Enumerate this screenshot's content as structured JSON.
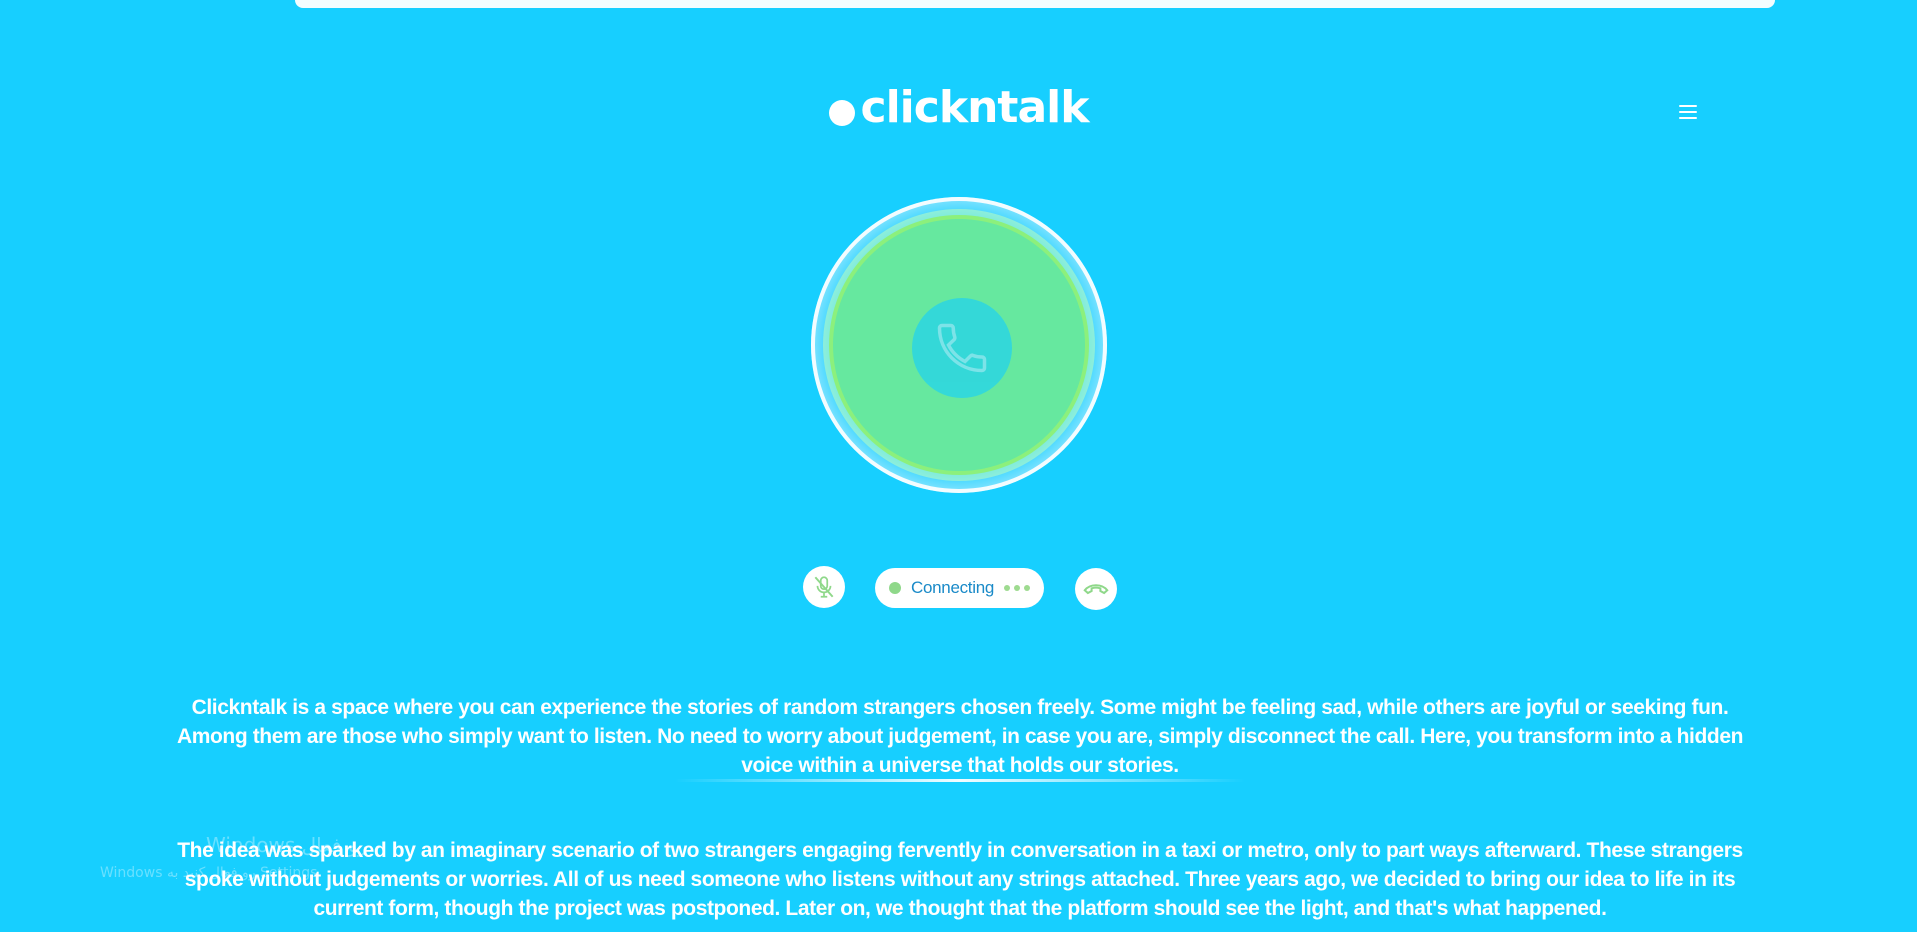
{
  "brand": {
    "logo_text": "clickntalk"
  },
  "menu": {
    "icon": "hamburger-menu-icon"
  },
  "call": {
    "icon": "phone-icon",
    "status_label": "Connecting"
  },
  "controls": {
    "mic_icon": "mic-muted-icon",
    "hangup_icon": "hang-up-icon"
  },
  "about": {
    "paragraph_1": "Clickntalk is a space where you can experience the stories of random strangers chosen freely. Some might be feeling sad, while others are joyful or seeking fun. Among them are those who simply want to listen. No need to worry about judgement, in case you are, simply disconnect the call. Here, you transform into a hidden voice within a universe that holds our stories.",
    "paragraph_2": "The idea was sparked by an imaginary scenario of two strangers engaging fervently in conversation in a taxi or metro, only to part ways afterward. These strangers spoke without judgements or worries. All of us need someone who listens without any strings attached. Three years ago, we decided to bring our idea to life in its current form, though the project was postponed. Later on, we thought that the platform should see the light, and that's what happened."
  },
  "watermark": {
    "title": "Windows رو فعال",
    "subtitle": "Windows رو فعال کنید به Settings"
  },
  "colors": {
    "background": "#17cfff",
    "orb_green": "#66e89f",
    "status_text": "#1a8ac8",
    "accent_green": "#8fd88a"
  }
}
